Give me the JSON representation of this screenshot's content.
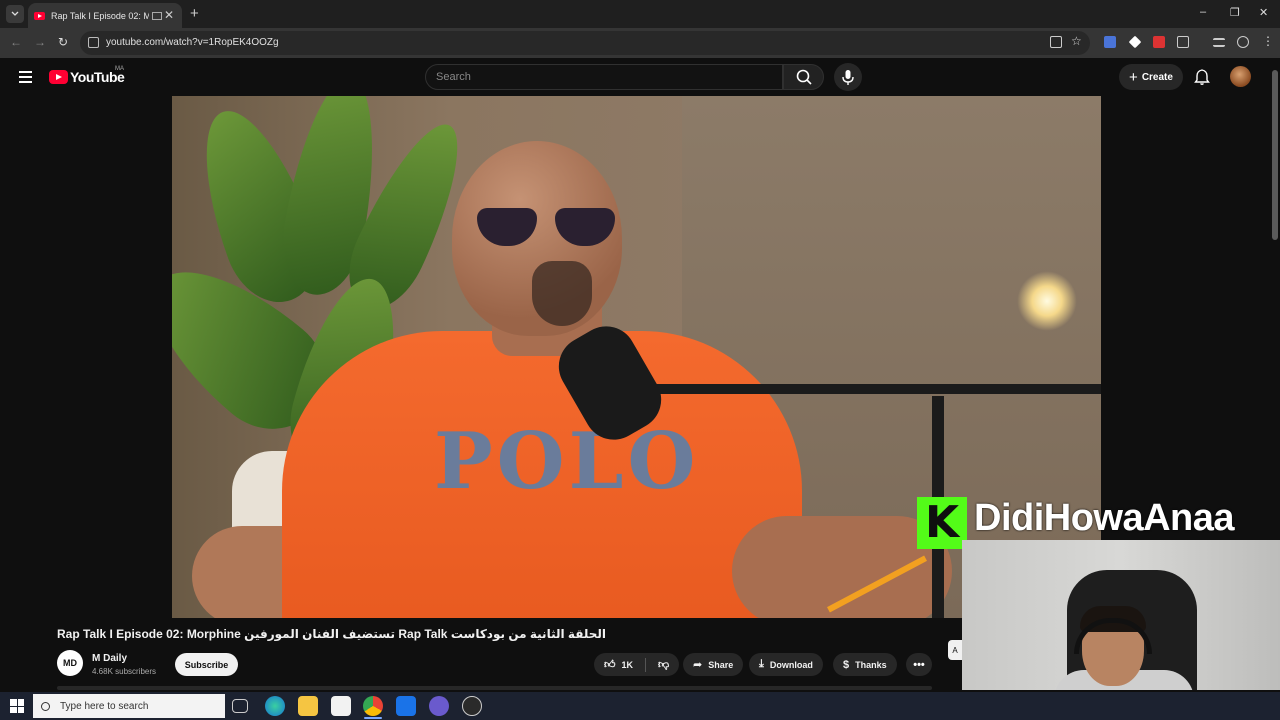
{
  "browser": {
    "tab_title": "Rap Talk I Episode 02: Morp",
    "url": "youtube.com/watch?v=1RopEK4OOZg",
    "window_controls": [
      "–",
      "❐",
      "✕"
    ]
  },
  "header": {
    "logo_text": "YouTube",
    "country_code": "MA",
    "search_placeholder": "Search",
    "create_label": "Create"
  },
  "overlay": {
    "kick_letter": "K",
    "streamer_name": "DidiHowaAnaa"
  },
  "video": {
    "title": "Rap Talk I Episode 02: Morphine تستضيف الفنان المورفين Rap Talk الحلقة الثانية من بودكاست",
    "shirt_print": "POLO",
    "channel": {
      "avatar_text": "MD",
      "name": "M Daily",
      "subscribers": "4.68K subscribers",
      "subscribe_label": "Subscribe"
    },
    "actions": {
      "likes": "1K",
      "share_label": "Share",
      "download_label": "Download",
      "thanks_label": "Thanks",
      "more_label": "•••"
    },
    "side_chip": "A"
  },
  "taskbar": {
    "search_label": "Type here to search"
  },
  "colors": {
    "youtube_red": "#ff0033",
    "kick_green": "#53fc18",
    "background": "#0f0f0f"
  }
}
